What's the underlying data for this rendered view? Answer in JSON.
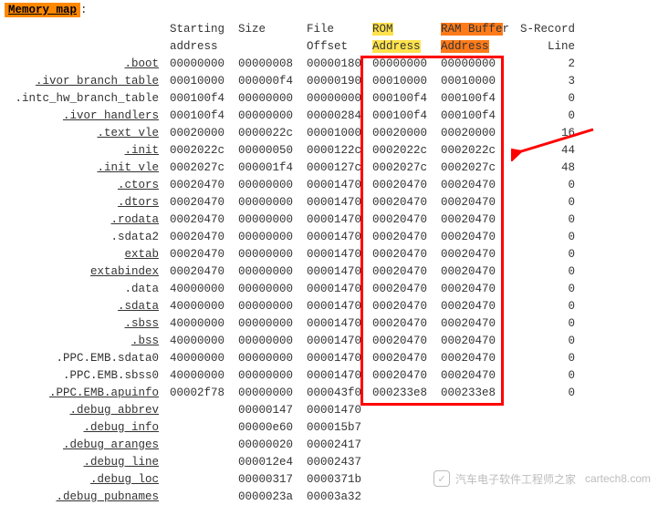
{
  "title": "Memory map",
  "colon": ":",
  "headers": {
    "section": "",
    "start1": "Starting",
    "start2": "address",
    "size1": "Size",
    "size2": "",
    "file1": "File",
    "file2": "Offset",
    "rom1": "ROM",
    "rom2": "Address",
    "ram1": "RAM Buffe",
    "ram1b": "r",
    "ram2": "Address",
    "line1": "S-Record",
    "line2": "Line"
  },
  "rows": [
    {
      "sec": ".boot",
      "start": "00000000",
      "size": "00000008",
      "file": "00000180",
      "rom": "00000000",
      "ram": "00000000",
      "line": "2",
      "u": true
    },
    {
      "sec": ".ivor_branch_table",
      "start": "00010000",
      "size": "000000f4",
      "file": "00000190",
      "rom": "00010000",
      "ram": "00010000",
      "line": "3",
      "u": true
    },
    {
      "sec": ".intc_hw_branch_table",
      "start": "000100f4",
      "size": "00000000",
      "file": "00000000",
      "rom": "000100f4",
      "ram": "000100f4",
      "line": "0",
      "u": false
    },
    {
      "sec": ".ivor_handlers",
      "start": "000100f4",
      "size": "00000000",
      "file": "00000284",
      "rom": "000100f4",
      "ram": "000100f4",
      "line": "0",
      "u": true
    },
    {
      "sec": ".text_vle",
      "start": "00020000",
      "size": "0000022c",
      "file": "00001000",
      "rom": "00020000",
      "ram": "00020000",
      "line": "16",
      "u": true
    },
    {
      "sec": ".init",
      "start": "0002022c",
      "size": "00000050",
      "file": "0000122c",
      "rom": "0002022c",
      "ram": "0002022c",
      "line": "44",
      "u": true
    },
    {
      "sec": ".init_vle",
      "start": "0002027c",
      "size": "000001f4",
      "file": "0000127c",
      "rom": "0002027c",
      "ram": "0002027c",
      "line": "48",
      "u": true
    },
    {
      "sec": ".ctors",
      "start": "00020470",
      "size": "00000000",
      "file": "00001470",
      "rom": "00020470",
      "ram": "00020470",
      "line": "0",
      "u": true
    },
    {
      "sec": ".dtors",
      "start": "00020470",
      "size": "00000000",
      "file": "00001470",
      "rom": "00020470",
      "ram": "00020470",
      "line": "0",
      "u": true
    },
    {
      "sec": ".rodata",
      "start": "00020470",
      "size": "00000000",
      "file": "00001470",
      "rom": "00020470",
      "ram": "00020470",
      "line": "0",
      "u": true
    },
    {
      "sec": ".sdata2",
      "start": "00020470",
      "size": "00000000",
      "file": "00001470",
      "rom": "00020470",
      "ram": "00020470",
      "line": "0",
      "u": false
    },
    {
      "sec": "extab",
      "start": "00020470",
      "size": "00000000",
      "file": "00001470",
      "rom": "00020470",
      "ram": "00020470",
      "line": "0",
      "u": true
    },
    {
      "sec": "extabindex",
      "start": "00020470",
      "size": "00000000",
      "file": "00001470",
      "rom": "00020470",
      "ram": "00020470",
      "line": "0",
      "u": true
    },
    {
      "sec": ".data",
      "start": "40000000",
      "size": "00000000",
      "file": "00001470",
      "rom": "00020470",
      "ram": "00020470",
      "line": "0",
      "u": false
    },
    {
      "sec": ".sdata",
      "start": "40000000",
      "size": "00000000",
      "file": "00001470",
      "rom": "00020470",
      "ram": "00020470",
      "line": "0",
      "u": true
    },
    {
      "sec": ".sbss",
      "start": "40000000",
      "size": "00000000",
      "file": "00001470",
      "rom": "00020470",
      "ram": "00020470",
      "line": "0",
      "u": true
    },
    {
      "sec": ".bss",
      "start": "40000000",
      "size": "00000000",
      "file": "00001470",
      "rom": "00020470",
      "ram": "00020470",
      "line": "0",
      "u": true
    },
    {
      "sec": ".PPC.EMB.sdata0",
      "start": "40000000",
      "size": "00000000",
      "file": "00001470",
      "rom": "00020470",
      "ram": "00020470",
      "line": "0",
      "u": false
    },
    {
      "sec": ".PPC.EMB.sbss0",
      "start": "40000000",
      "size": "00000000",
      "file": "00001470",
      "rom": "00020470",
      "ram": "00020470",
      "line": "0",
      "u": false
    },
    {
      "sec": ".PPC.EMB.apuinfo",
      "start": "00002f78",
      "size": "00000000",
      "file": "000043f0",
      "rom": "000233e8",
      "ram": "000233e8",
      "line": "0",
      "u": true
    },
    {
      "sec": ".debug_abbrev",
      "start": "",
      "size": "00000147",
      "file": "00001470",
      "rom": "",
      "ram": "",
      "line": "",
      "u": true
    },
    {
      "sec": ".debug_info",
      "start": "",
      "size": "00000e60",
      "file": "000015b7",
      "rom": "",
      "ram": "",
      "line": "",
      "u": true
    },
    {
      "sec": ".debug_aranges",
      "start": "",
      "size": "00000020",
      "file": "00002417",
      "rom": "",
      "ram": "",
      "line": "",
      "u": true
    },
    {
      "sec": ".debug_line",
      "start": "",
      "size": "000012e4",
      "file": "00002437",
      "rom": "",
      "ram": "",
      "line": "",
      "u": true
    },
    {
      "sec": ".debug_loc",
      "start": "",
      "size": "00000317",
      "file": "0000371b",
      "rom": "",
      "ram": "",
      "line": "",
      "u": true
    },
    {
      "sec": ".debug_pubnames",
      "start": "",
      "size": "0000023a",
      "file": "00003a32",
      "rom": "",
      "ram": "",
      "line": "",
      "u": true
    }
  ],
  "watermark": {
    "text1": "汽车电子软件工程师之家",
    "text2": "cartech8.com"
  }
}
